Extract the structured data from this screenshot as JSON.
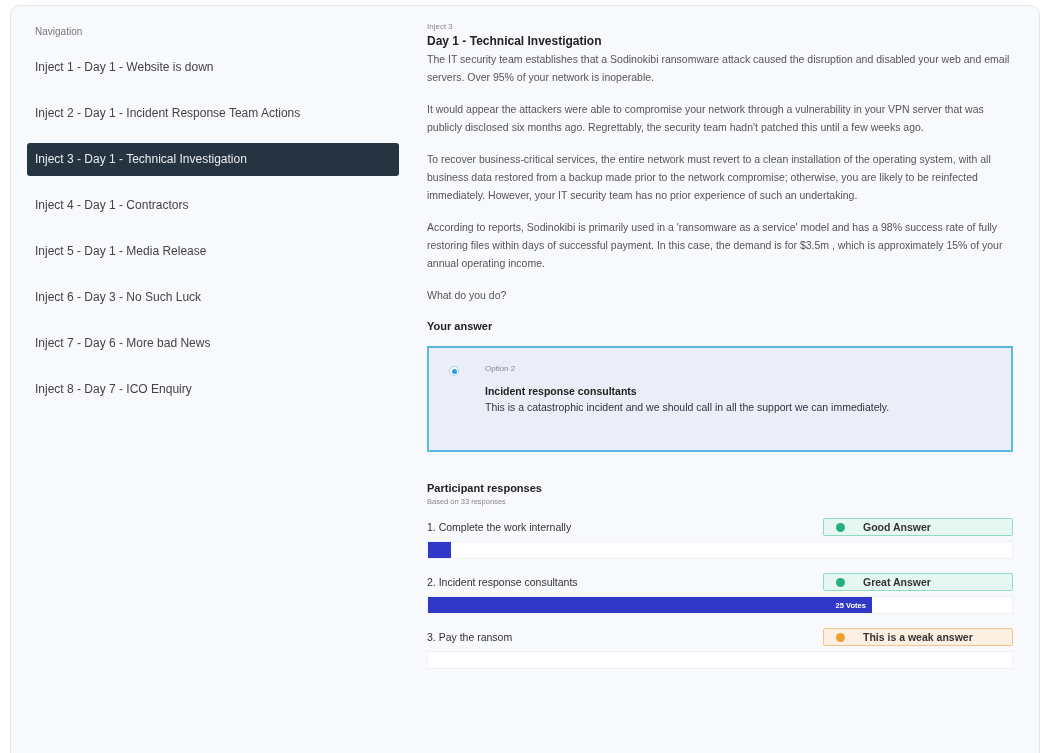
{
  "navigation": {
    "title": "Navigation",
    "items": [
      {
        "label": "Inject 1 - Day 1 - Website is down",
        "selected": false
      },
      {
        "label": "Inject 2 - Day 1 - Incident Response Team Actions",
        "selected": false
      },
      {
        "label": "Inject 3 - Day 1 - Technical Investigation",
        "selected": true
      },
      {
        "label": "Inject 4 - Day 1 - Contractors",
        "selected": false
      },
      {
        "label": "Inject 5 - Day 1 - Media Release",
        "selected": false
      },
      {
        "label": "Inject 6 - Day 3 - No Such Luck",
        "selected": false
      },
      {
        "label": "Inject 7 - Day 6 - More bad News",
        "selected": false
      },
      {
        "label": "Inject 8 - Day 7 - ICO Enquiry",
        "selected": false
      }
    ]
  },
  "inject": {
    "eyebrow": "Inject 3",
    "title": "Day 1 - Technical Investigation",
    "paragraphs": [
      "The IT security team establishes that a Sodinokibi ransomware attack caused the disruption and disabled your web and email servers. Over 95% of your network is inoperable.",
      "It would appear the attackers were able to compromise your network through a vulnerability in your VPN server that was publicly disclosed six months ago. Regrettably, the security team hadn't patched this until a few weeks ago.",
      "To recover business-critical services, the entire network must revert to a clean installation of the operating system, with all business data restored from a backup made prior to the network compromise; otherwise, you are likely to be reinfected immediately. However, your IT security team has no prior experience of such an undertaking.",
      "According to reports, Sodinokibi is primarily used in a 'ransomware as a service' model and has a 98% success rate of fully restoring files within days of successful payment. In this case, the demand is for $3.5m , which is approximately 15% of your annual operating income.",
      "What do you do?"
    ]
  },
  "your_answer": {
    "heading": "Your answer",
    "option_label": "Option 2",
    "title": "Incident response consultants",
    "description": "This is a catastrophic incident and we should call in all the support we can immediately.",
    "selected": true
  },
  "responses": {
    "heading": "Participant responses",
    "subtitle": "Based on 33 responses",
    "items": [
      {
        "label": "1. Complete the work internally",
        "badge": "Good Answer",
        "kind": "good",
        "level": 0.04
      },
      {
        "label": "2. Incident response consultants",
        "badge": "Great Answer",
        "kind": "good",
        "level": 0.76,
        "votes": "25 Votes"
      },
      {
        "label": "3. Pay the ransom",
        "badge": "This is a weak answer",
        "kind": "weak"
      }
    ]
  }
}
